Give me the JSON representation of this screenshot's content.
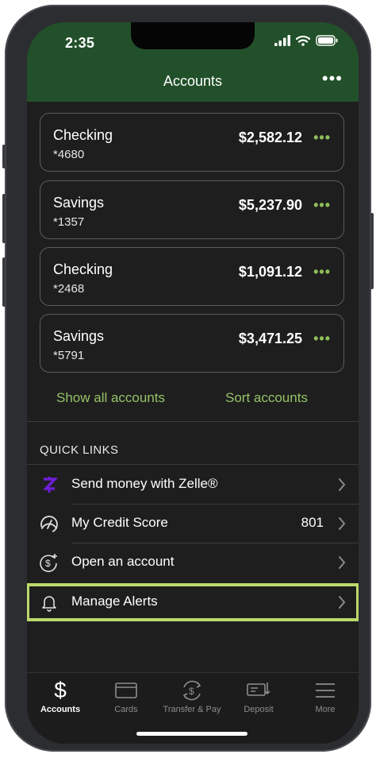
{
  "status_bar": {
    "time": "2:35"
  },
  "header": {
    "title": "Accounts",
    "menu_icon": "more-horizontal-icon"
  },
  "accounts": [
    {
      "name": "Checking",
      "number": "*4680",
      "balance": "$2,582.12"
    },
    {
      "name": "Savings",
      "number": "*1357",
      "balance": "$5,237.90"
    },
    {
      "name": "Checking",
      "number": "*2468",
      "balance": "$1,091.12"
    },
    {
      "name": "Savings",
      "number": "*5791",
      "balance": "$3,471.25"
    }
  ],
  "account_actions": {
    "show_all": "Show all accounts",
    "sort": "Sort accounts"
  },
  "quick_links": {
    "heading": "QUICK LINKS",
    "items": [
      {
        "label": "Send money with Zelle®",
        "icon": "zelle-icon",
        "value": ""
      },
      {
        "label": "My Credit Score",
        "icon": "gauge-icon",
        "value": "801"
      },
      {
        "label": "Open an account",
        "icon": "dollar-plus-icon",
        "value": ""
      },
      {
        "label": "Manage Alerts",
        "icon": "bell-icon",
        "value": ""
      }
    ]
  },
  "tabs": [
    {
      "label": "Accounts",
      "icon": "dollar-icon",
      "active": true
    },
    {
      "label": "Cards",
      "icon": "card-icon",
      "active": false
    },
    {
      "label": "Transfer & Pay",
      "icon": "transfer-icon",
      "active": false
    },
    {
      "label": "Deposit",
      "icon": "check-deposit-icon",
      "active": false
    },
    {
      "label": "More",
      "icon": "menu-icon",
      "active": false
    }
  ],
  "colors": {
    "header_bg": "#22502a",
    "accent_green": "#96c268",
    "highlight": "#bcd96b",
    "zelle": "#6d1ed4"
  }
}
